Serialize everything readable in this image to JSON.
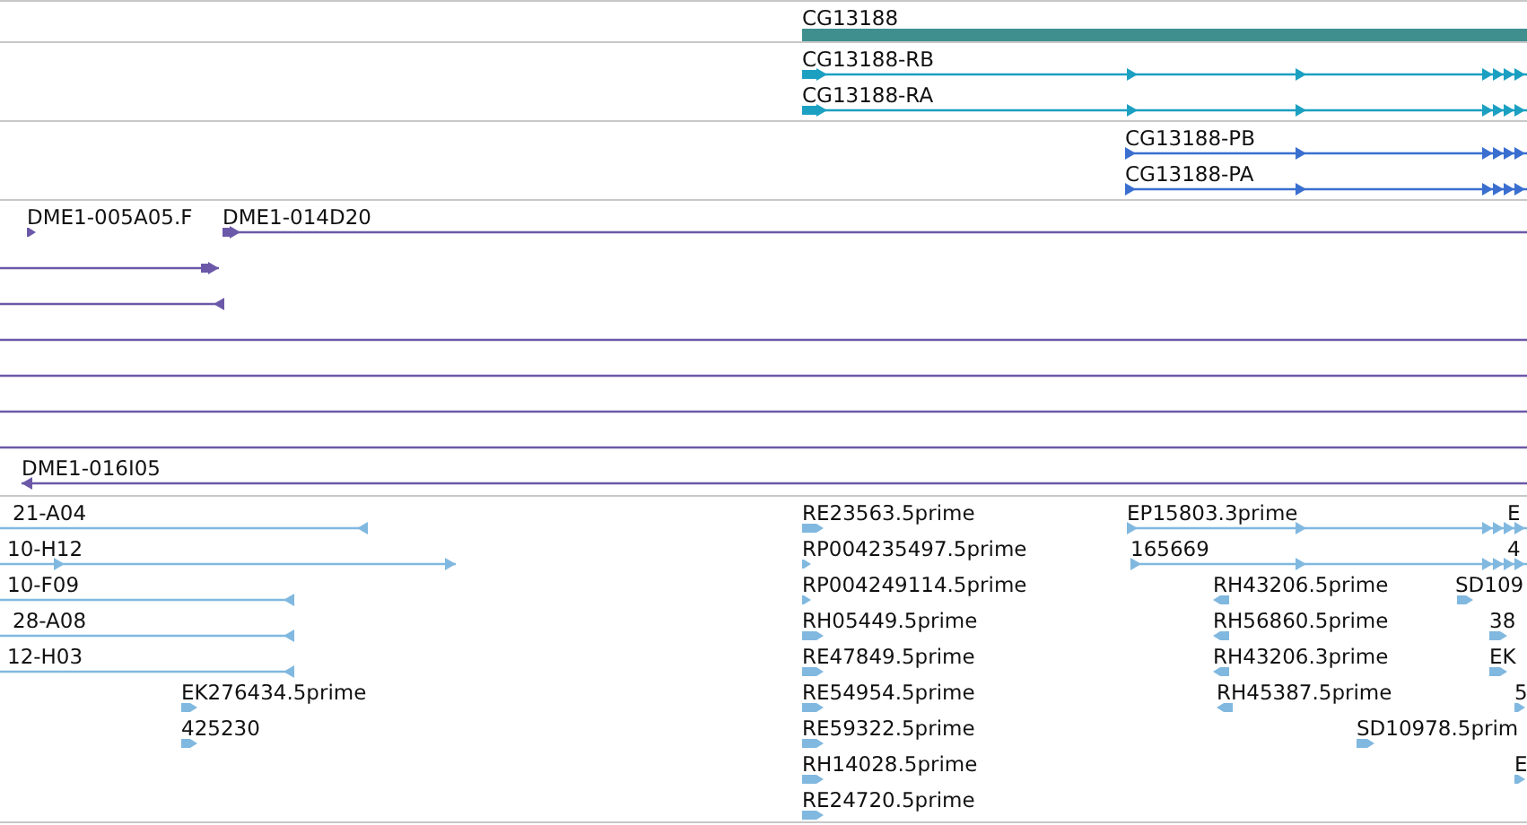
{
  "tracks": [
    {
      "kind": "gene",
      "features": [
        {
          "label": "CG13188",
          "kind": "bar"
        }
      ]
    },
    {
      "kind": "mrna",
      "features": [
        {
          "label": "CG13188-RB",
          "kind": "line",
          "reverse": false
        },
        {
          "label": "CG13188-RA",
          "kind": "line",
          "reverse": false
        }
      ]
    },
    {
      "kind": "protein",
      "features": [
        {
          "label": "CG13188-PB",
          "kind": "line",
          "reverse": false
        },
        {
          "label": "CG13188-PA",
          "kind": "line",
          "reverse": false
        }
      ]
    },
    {
      "kind": "clone",
      "features": [
        {
          "label": "DME1-005A05.F",
          "kind": "tag",
          "reverse": false
        },
        {
          "label": "DME1-014D20",
          "kind": "line",
          "reverse": false
        },
        {
          "kind": "line",
          "reverse": false
        },
        {
          "kind": "line",
          "reverse": true
        },
        {
          "kind": "line"
        },
        {
          "kind": "line"
        },
        {
          "kind": "line"
        },
        {
          "kind": "line"
        },
        {
          "label": "DME1-016I05",
          "kind": "line",
          "reverse": true
        }
      ]
    },
    {
      "kind": "est",
      "features": [
        {
          "label": "21-A04",
          "kind": "line",
          "reverse": true
        },
        {
          "label": "RE23563.5prime",
          "kind": "tag",
          "reverse": false
        },
        {
          "label": "EP15803.3prime",
          "kind": "line",
          "reverse": false
        },
        {
          "label": "E",
          "kind": "label"
        },
        {
          "label": "10-H12",
          "kind": "line",
          "reverse": false
        },
        {
          "label": "RP004235497.5prime",
          "kind": "tag",
          "reverse": false
        },
        {
          "label": "165669",
          "kind": "line",
          "reverse": false
        },
        {
          "label": "4",
          "kind": "label"
        },
        {
          "label": "10-F09",
          "kind": "line",
          "reverse": true
        },
        {
          "label": "RP004249114.5prime",
          "kind": "tag",
          "reverse": false
        },
        {
          "label": "RH43206.5prime",
          "kind": "tag",
          "reverse": true
        },
        {
          "label": "SD109",
          "kind": "tag",
          "reverse": false
        },
        {
          "label": "28-A08",
          "kind": "line",
          "reverse": true
        },
        {
          "label": "RH05449.5prime",
          "kind": "tag",
          "reverse": false
        },
        {
          "label": "RH56860.5prime",
          "kind": "tag",
          "reverse": true
        },
        {
          "label": "38",
          "kind": "tag",
          "reverse": false
        },
        {
          "label": "12-H03",
          "kind": "line",
          "reverse": true
        },
        {
          "label": "RE47849.5prime",
          "kind": "tag",
          "reverse": false
        },
        {
          "label": "RH43206.3prime",
          "kind": "tag",
          "reverse": true
        },
        {
          "label": "EK",
          "kind": "tag",
          "reverse": false
        },
        {
          "label": "EK276434.5prime",
          "kind": "tag",
          "reverse": false
        },
        {
          "label": "RE54954.5prime",
          "kind": "tag",
          "reverse": false
        },
        {
          "label": "RH45387.5prime",
          "kind": "tag",
          "reverse": true
        },
        {
          "label": "5",
          "kind": "tag",
          "reverse": false
        },
        {
          "label": "425230",
          "kind": "tag",
          "reverse": false
        },
        {
          "label": "RE59322.5prime",
          "kind": "tag",
          "reverse": false
        },
        {
          "label": "SD10978.5prim",
          "kind": "tag",
          "reverse": false
        },
        {
          "label": "RH14028.5prime",
          "kind": "tag",
          "reverse": false
        },
        {
          "label": "E",
          "kind": "tag",
          "reverse": false
        },
        {
          "label": "RE24720.5prime",
          "kind": "tag",
          "reverse": false
        }
      ]
    }
  ]
}
